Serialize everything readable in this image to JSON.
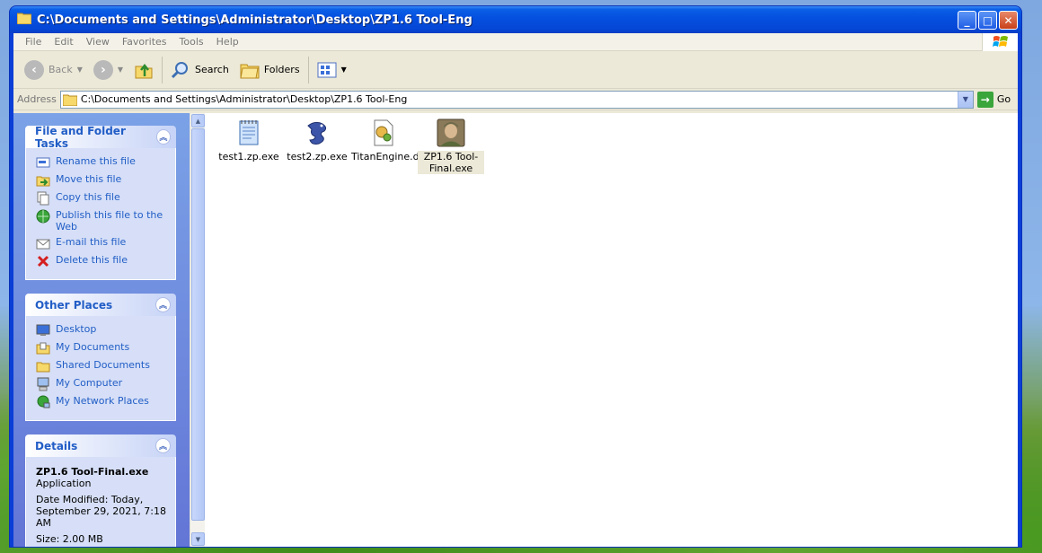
{
  "window": {
    "title": "C:\\Documents and Settings\\Administrator\\Desktop\\ZP1.6 Tool-Eng",
    "minimize": "_",
    "maximize": "□",
    "close": "✕"
  },
  "menu": [
    "File",
    "Edit",
    "View",
    "Favorites",
    "Tools",
    "Help"
  ],
  "toolbar": {
    "back": "Back",
    "search": "Search",
    "folders": "Folders"
  },
  "address": {
    "label": "Address",
    "value": "C:\\Documents and Settings\\Administrator\\Desktop\\ZP1.6 Tool-Eng",
    "go": "Go"
  },
  "taskpane": {
    "file_tasks": {
      "title": "File and Folder Tasks",
      "items": [
        "Rename this file",
        "Move this file",
        "Copy this file",
        "Publish this file to the Web",
        "E-mail this file",
        "Delete this file"
      ]
    },
    "other_places": {
      "title": "Other Places",
      "items": [
        "Desktop",
        "My Documents",
        "Shared Documents",
        "My Computer",
        "My Network Places"
      ]
    },
    "details": {
      "title": "Details",
      "name": "ZP1.6 Tool-Final.exe",
      "type": "Application",
      "modified": "Date Modified: Today, September 29, 2021, 7:18 AM",
      "size": "Size: 2.00 MB"
    }
  },
  "files": [
    {
      "name": "test1.zp.exe",
      "icon": "notepad-icon",
      "selected": false
    },
    {
      "name": "test2.zp.exe",
      "icon": "dragon-icon",
      "selected": false
    },
    {
      "name": "TitanEngine.dll",
      "icon": "dll-icon",
      "selected": false
    },
    {
      "name": "ZP1.6 Tool-Final.exe",
      "icon": "portrait-icon",
      "selected": true
    }
  ],
  "colors": {
    "titlebar": "#0551e0",
    "taskpane_link": "#215dc6",
    "taskpane_bg": "#d6dff7"
  }
}
